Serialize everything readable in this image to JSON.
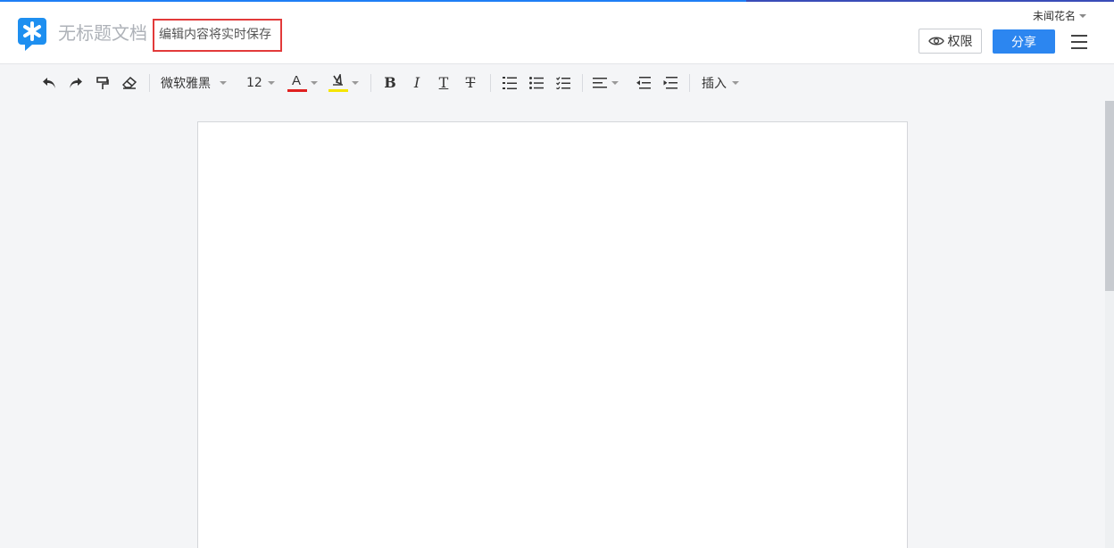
{
  "header": {
    "doc_title": "无标题文档",
    "save_status": "编辑内容将实时保存",
    "user_name": "未闻花名",
    "permission_label": "权限",
    "share_label": "分享"
  },
  "toolbar": {
    "font_family": "微软雅黑",
    "font_size": "12",
    "insert_label": "插入",
    "font_color": "#e02020",
    "highlight_color": "#f5e500"
  },
  "colors": {
    "accent": "#2c86f0",
    "highlight_border": "#e23a3a"
  }
}
